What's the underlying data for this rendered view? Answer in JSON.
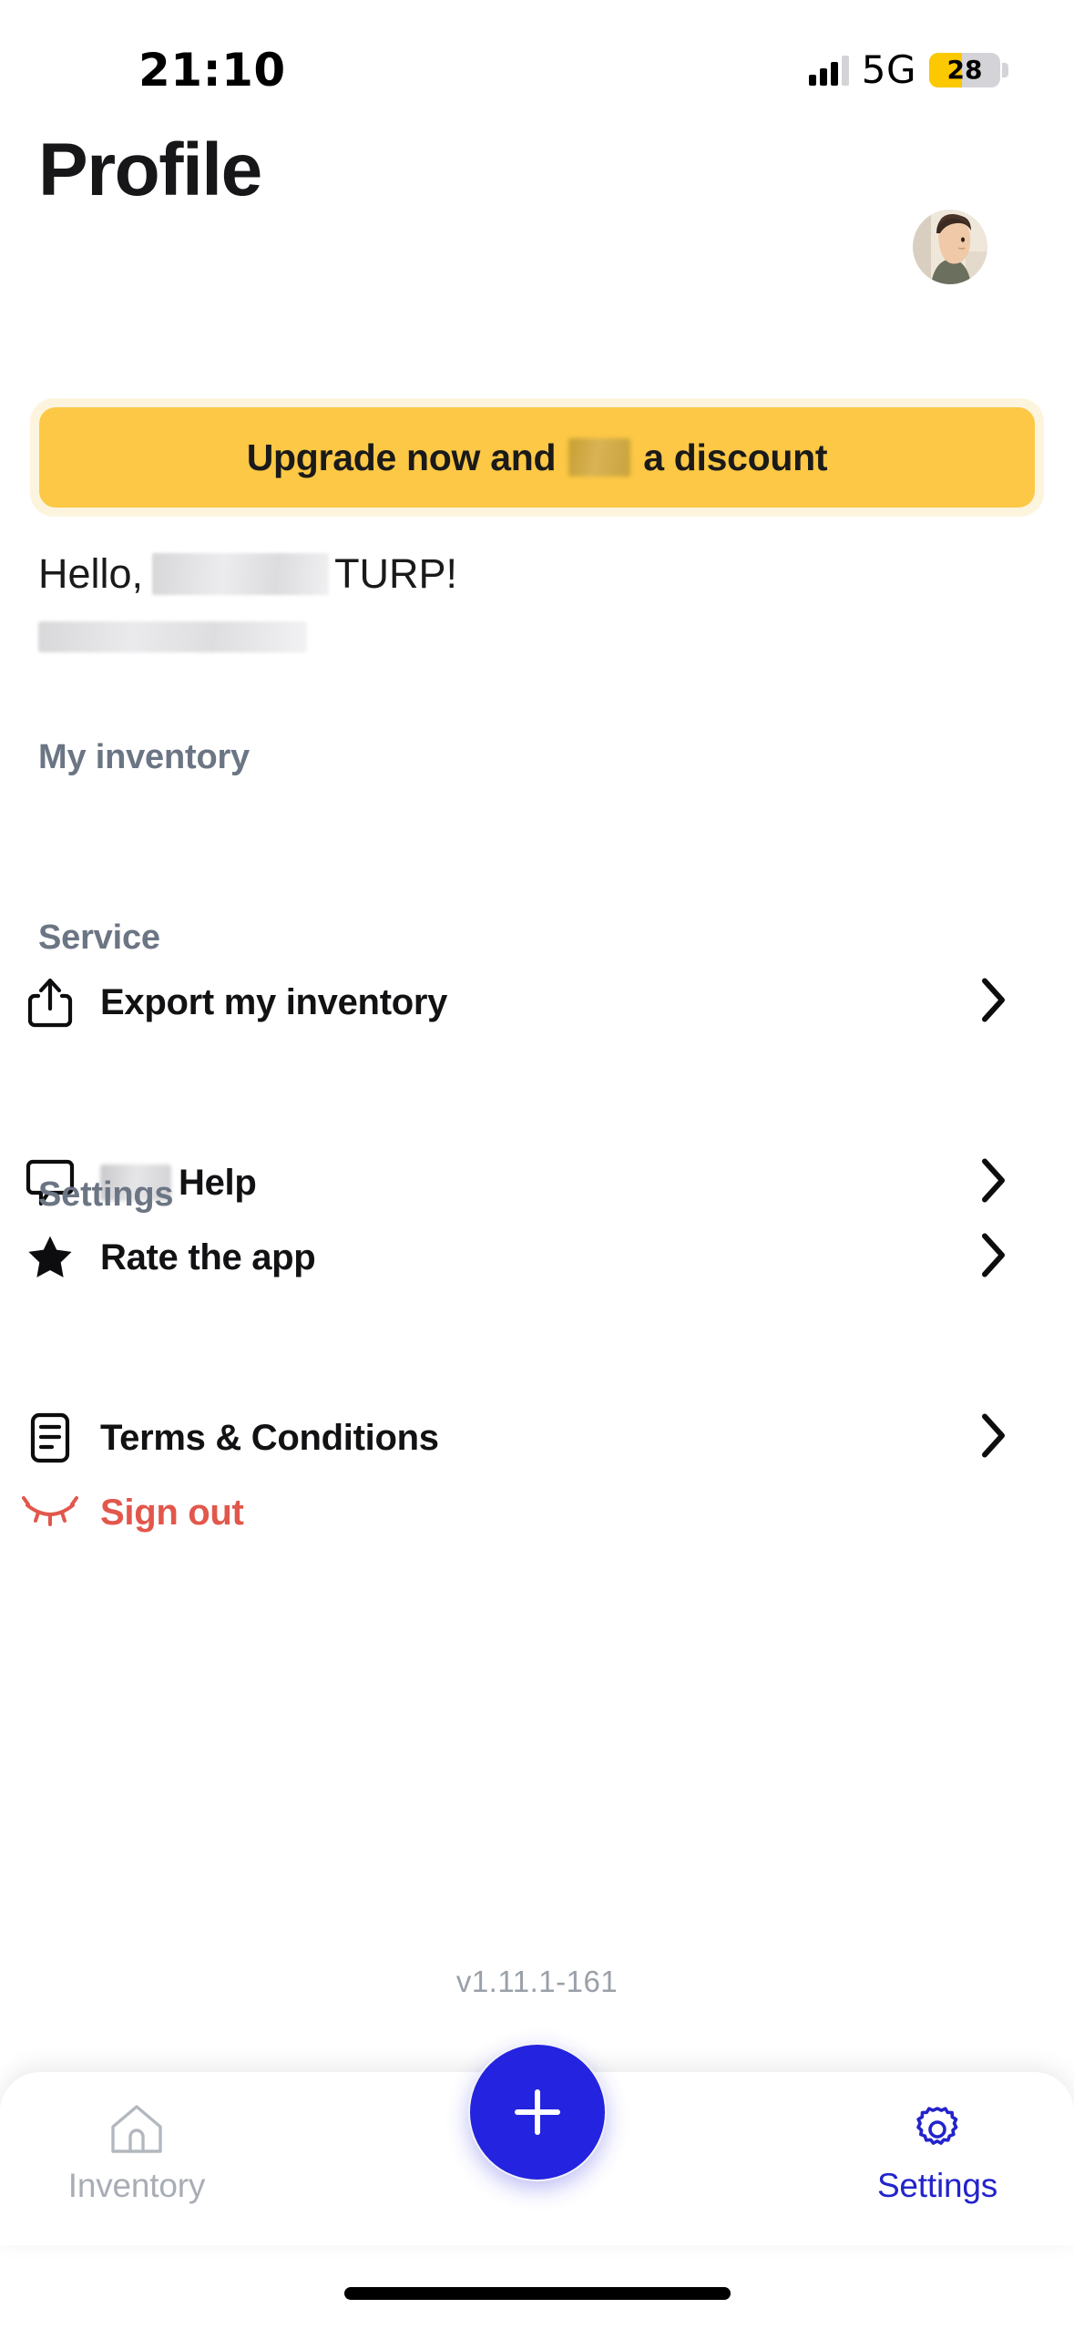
{
  "status_bar": {
    "time": "21:10",
    "network": "5G",
    "battery_percent": "28",
    "battery_fill_color": "#fcc800"
  },
  "header": {
    "title": "Profile",
    "avatar_alt": "user-avatar"
  },
  "promo_banner": {
    "text_before": "Upgrade now and",
    "redacted": "",
    "text_after": "a discount",
    "background_color": "#fcc845",
    "outer_color": "#fdf4de"
  },
  "greeting": {
    "prefix": "Hello,",
    "redacted_name": "",
    "suffix": "TURP!",
    "email_redacted": ""
  },
  "sections": [
    {
      "title": "My inventory",
      "items": [
        {
          "label": "Export my inventory",
          "icon": "share-export-icon",
          "has_chevron": true,
          "redacted_prefix": false,
          "danger": false
        }
      ]
    },
    {
      "title": "Service",
      "items": [
        {
          "label": "Help",
          "icon": "chat-bubble-icon",
          "has_chevron": true,
          "redacted_prefix": true,
          "danger": false
        },
        {
          "label": "Rate the app",
          "icon": "star-icon",
          "has_chevron": true,
          "redacted_prefix": false,
          "danger": false
        }
      ]
    },
    {
      "title": "Settings",
      "items": [
        {
          "label": "Terms & Conditions",
          "icon": "document-icon",
          "has_chevron": true,
          "redacted_prefix": false,
          "danger": false
        },
        {
          "label": "Sign out",
          "icon": "eye-closed-icon",
          "has_chevron": false,
          "redacted_prefix": false,
          "danger": true
        }
      ]
    }
  ],
  "version": "v1.11.1-161",
  "bottom_nav": {
    "left": {
      "label": "Inventory",
      "icon": "home-icon",
      "active": false
    },
    "fab": {
      "icon": "plus-icon",
      "color": "#2323e0"
    },
    "right": {
      "label": "Settings",
      "icon": "gear-icon",
      "active": true
    }
  },
  "colors": {
    "accent_blue": "#2323e0",
    "accent_yellow": "#fcc845",
    "danger_red": "#e2574c",
    "section_header": "#6b7584"
  }
}
